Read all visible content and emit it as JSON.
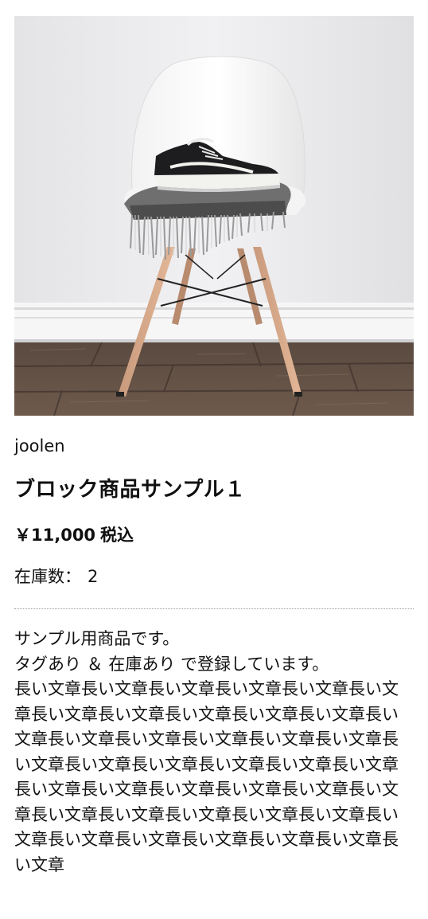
{
  "product": {
    "image_alt": "",
    "brand": "joolen",
    "title": "ブロック商品サンプル１",
    "price": "￥11,000",
    "tax_label": "税込",
    "stock_label": "在庫数：",
    "stock_value": "2",
    "description": "サンプル用商品です。\nタグあり ＆ 在庫あり で登録しています。\n長い文章長い文章長い文章長い文章長い文章長い文章長い文章長い文章長い文章長い文章長い文章長い文章長い文章長い文章長い文章長い文章長い文章長い文章長い文章長い文章長い文章長い文章長い文章長い文章長い文章長い文章長い文章長い文章長い文章長い文章長い文章長い文章長い文章長い文章長い文章長い文章長い文章長い文章長い文章長い文章長い文章"
  },
  "colors": {
    "text": "#111111",
    "divider": "#9a9a9a",
    "background": "#ffffff"
  }
}
